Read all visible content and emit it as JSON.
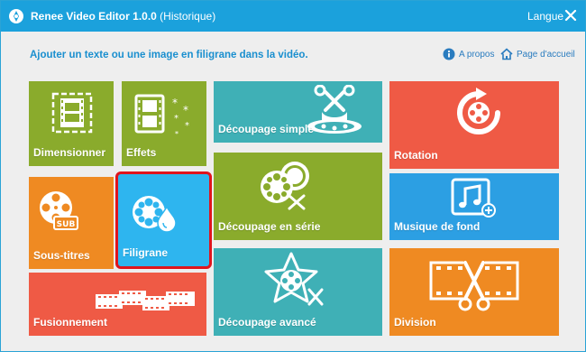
{
  "window": {
    "title": "Renee Video Editor 1.0.0",
    "title_suffix": "(Historique)",
    "language_label": "Langue",
    "close_symbol": "✕"
  },
  "header": {
    "subtitle": "Ajouter un texte ou une image en filigrane dans la vidéo.",
    "about_label": "A propos",
    "home_label": "Page d'accueil"
  },
  "tiles": {
    "resize": {
      "label": "Dimensionner",
      "color": "#8aab2c",
      "icon": "film-frame-icon"
    },
    "effects": {
      "label": "Effets",
      "color": "#8aab2c",
      "icon": "film-sparkle-icon"
    },
    "subtitles": {
      "label": "Sous-titres",
      "color": "#ef8a22",
      "icon": "film-reel-sub-icon"
    },
    "watermark": {
      "label": "Filigrane",
      "color": "#2eb5ef",
      "icon": "film-reel-drop-icon"
    },
    "merge": {
      "label": "Fusionnement",
      "color": "#ef5a45",
      "icon": "film-strip-chain-icon"
    },
    "cut_simple": {
      "label": "Découpage simple",
      "color": "#3fb0b6",
      "icon": "scissors-reel-icon"
    },
    "cut_series": {
      "label": "Découpage en série",
      "color": "#8aab2c",
      "icon": "scissors-reels-icon"
    },
    "cut_advanced": {
      "label": "Découpage avancé",
      "color": "#3fb0b6",
      "icon": "star-reel-scissors-icon"
    },
    "rotation": {
      "label": "Rotation",
      "color": "#ef5a45",
      "icon": "rotate-reel-icon"
    },
    "music": {
      "label": "Musique de fond",
      "color": "#2c9fe3",
      "icon": "music-note-icon"
    },
    "split": {
      "label": "Division",
      "color": "#ef8a22",
      "icon": "film-scissors-icon"
    }
  },
  "selected_tile": "watermark",
  "colors": {
    "titlebar": "#1ba1dc",
    "background": "#eeeeee",
    "subtitle": "#1a8fcf",
    "selection": "#e0141d"
  }
}
